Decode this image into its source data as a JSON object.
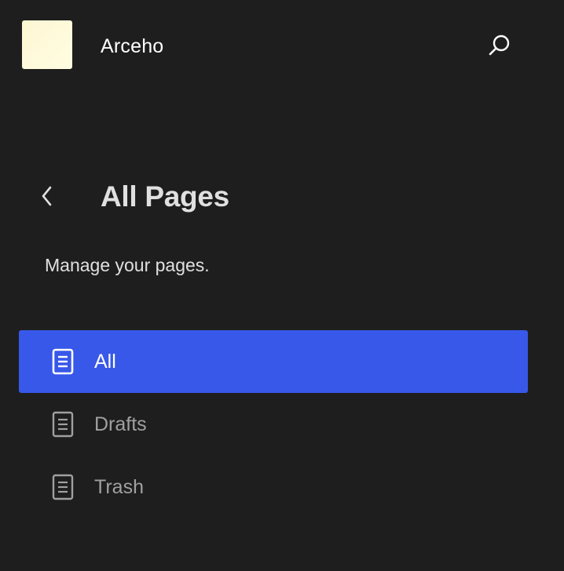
{
  "header": {
    "site_name": "Arceho",
    "logo_color": "#fef9d8",
    "search_icon": "search-icon"
  },
  "navigation": {
    "back_icon": "chevron-left-icon",
    "title": "All Pages",
    "description": "Manage your pages."
  },
  "menu": {
    "items": [
      {
        "label": "All",
        "icon": "page-icon",
        "active": true
      },
      {
        "label": "Drafts",
        "icon": "page-icon",
        "active": false
      },
      {
        "label": "Trash",
        "icon": "page-icon",
        "active": false
      }
    ]
  },
  "colors": {
    "background": "#1e1e1e",
    "accent": "#3858e9",
    "text_primary": "#e0e0e0",
    "text_muted": "#a0a0a0"
  }
}
